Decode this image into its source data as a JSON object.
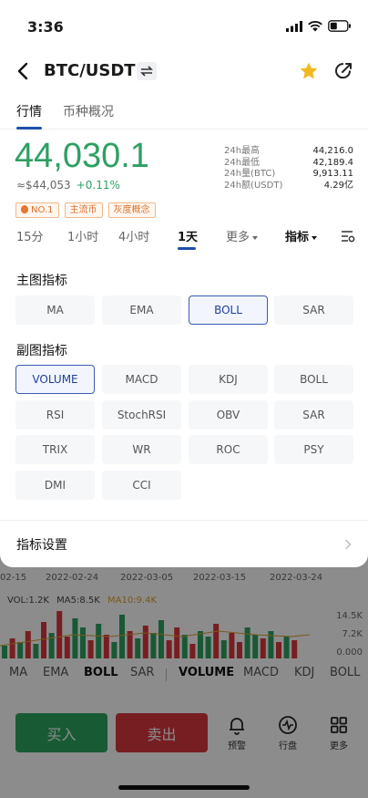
{
  "status": {
    "time": "3:36"
  },
  "nav": {
    "title": "BTC/USDT"
  },
  "tabs": [
    {
      "label": "行情"
    },
    {
      "label": "币种概况"
    }
  ],
  "price": {
    "last": "44,030.1",
    "fiat": "≈$44,053",
    "change": "+0.11%"
  },
  "stats": [
    {
      "key": "24h最高",
      "value": "44,216.0"
    },
    {
      "key": "24h最低",
      "value": "42,189.4"
    },
    {
      "key": "24h量(BTC)",
      "value": "9,913.11"
    },
    {
      "key": "24h额(USDT)",
      "value": "4.29亿"
    }
  ],
  "tags": [
    "NO.1",
    "主流币",
    "灰度概念"
  ],
  "periods": [
    "15分",
    "1小时",
    "4小时",
    "1天",
    "更多",
    "指标"
  ],
  "main_indicators": {
    "title": "主图指标",
    "items": [
      "MA",
      "EMA",
      "BOLL",
      "SAR"
    ],
    "selected": "BOLL"
  },
  "sub_indicators": {
    "title": "副图指标",
    "items": [
      "VOLUME",
      "MACD",
      "KDJ",
      "BOLL",
      "RSI",
      "StochRSI",
      "OBV",
      "SAR",
      "TRIX",
      "WR",
      "ROC",
      "PSY",
      "DMI",
      "CCI"
    ],
    "selected": "VOLUME"
  },
  "settings": {
    "label": "指标设置"
  },
  "background": {
    "dates": [
      "02-15",
      "2022-02-24",
      "2022-03-05",
      "2022-03-15",
      "2022-03-24"
    ],
    "vol_legend": {
      "vol": "VOL:1.2K",
      "ma5": "MA5:8.5K",
      "ma10": "MA10:9.4K"
    },
    "axis": [
      "14.5K",
      "7.2K",
      "0.000"
    ],
    "indicator_tabs": [
      "MA",
      "EMA",
      "BOLL",
      "SAR",
      "VOLUME",
      "MACD",
      "KDJ",
      "BOLL"
    ],
    "buy": "买入",
    "sell": "卖出",
    "bottom_items": [
      "预警",
      "行盘",
      "更多"
    ]
  },
  "colors": {
    "up": "#2ea062",
    "down": "#d9383f",
    "accent": "#1f4fa8",
    "tag": "#d9712d"
  }
}
